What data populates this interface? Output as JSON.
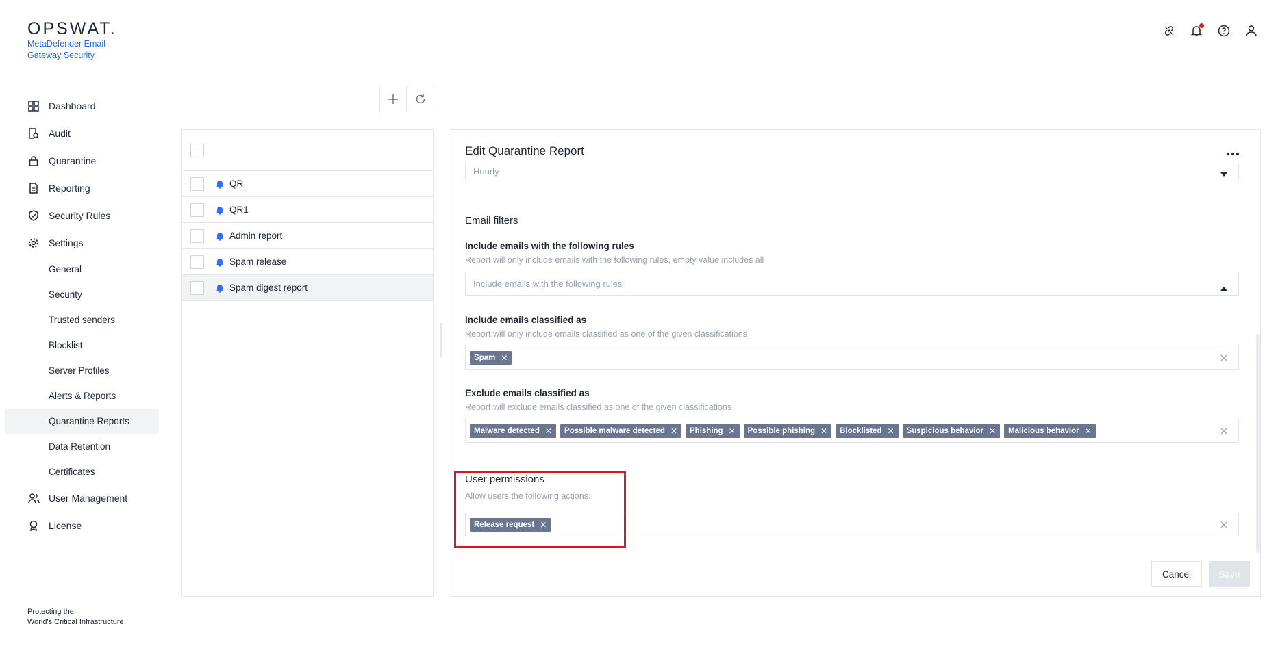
{
  "brand": {
    "logo": "OPSWAT.",
    "product": "MetaDefender Email Gateway Security",
    "tagline_1": "Protecting the",
    "tagline_2": "World's Critical Infrastructure"
  },
  "nav": {
    "items": [
      {
        "label": "Dashboard",
        "icon": "dashboard-icon"
      },
      {
        "label": "Audit",
        "icon": "audit-icon"
      },
      {
        "label": "Quarantine",
        "icon": "lock-icon"
      },
      {
        "label": "Reporting",
        "icon": "document-icon"
      },
      {
        "label": "Security Rules",
        "icon": "shield-check-icon"
      },
      {
        "label": "Settings",
        "icon": "gear-icon"
      }
    ],
    "settings_sub": [
      "General",
      "Security",
      "Trusted senders",
      "Blocklist",
      "Server Profiles",
      "Alerts & Reports",
      "Quarantine Reports",
      "Data Retention",
      "Certificates"
    ],
    "active_sub": "Quarantine Reports",
    "bottom_items": [
      {
        "label": "User Management",
        "icon": "users-icon"
      },
      {
        "label": "License",
        "icon": "license-icon"
      }
    ]
  },
  "reports": [
    "QR",
    "QR1",
    "Admin report",
    "Spam release",
    "Spam digest report"
  ],
  "selected_report": "Spam digest report",
  "edit": {
    "title": "Edit Quarantine Report",
    "frequency_value": "Hourly",
    "email_filters_heading": "Email filters",
    "include_rules": {
      "label": "Include emails with the following rules",
      "hint": "Report will only include emails with the following rules, empty value includes all",
      "placeholder": "Include emails with the following rules"
    },
    "include_classified": {
      "label": "Include emails classified as",
      "hint": "Report will only include emails classified as one of the given classifications",
      "chips": [
        "Spam"
      ]
    },
    "exclude_classified": {
      "label": "Exclude emails classified as",
      "hint": "Report will exclude emails classified as one of the given classifications",
      "chips": [
        "Malware detected",
        "Possible malware detected",
        "Phishing",
        "Possible phishing",
        "Blocklisted",
        "Suspicious behavior",
        "Malicious behavior"
      ]
    },
    "user_permissions": {
      "heading": "User permissions",
      "hint": "Allow users the following actions:",
      "chips": [
        "Release request"
      ]
    },
    "cancel_label": "Cancel",
    "save_label": "Save"
  },
  "colors": {
    "accent": "#1d6bfc",
    "chip": "#6a7592",
    "highlight": "#e0141e",
    "notification": "#d92121"
  }
}
